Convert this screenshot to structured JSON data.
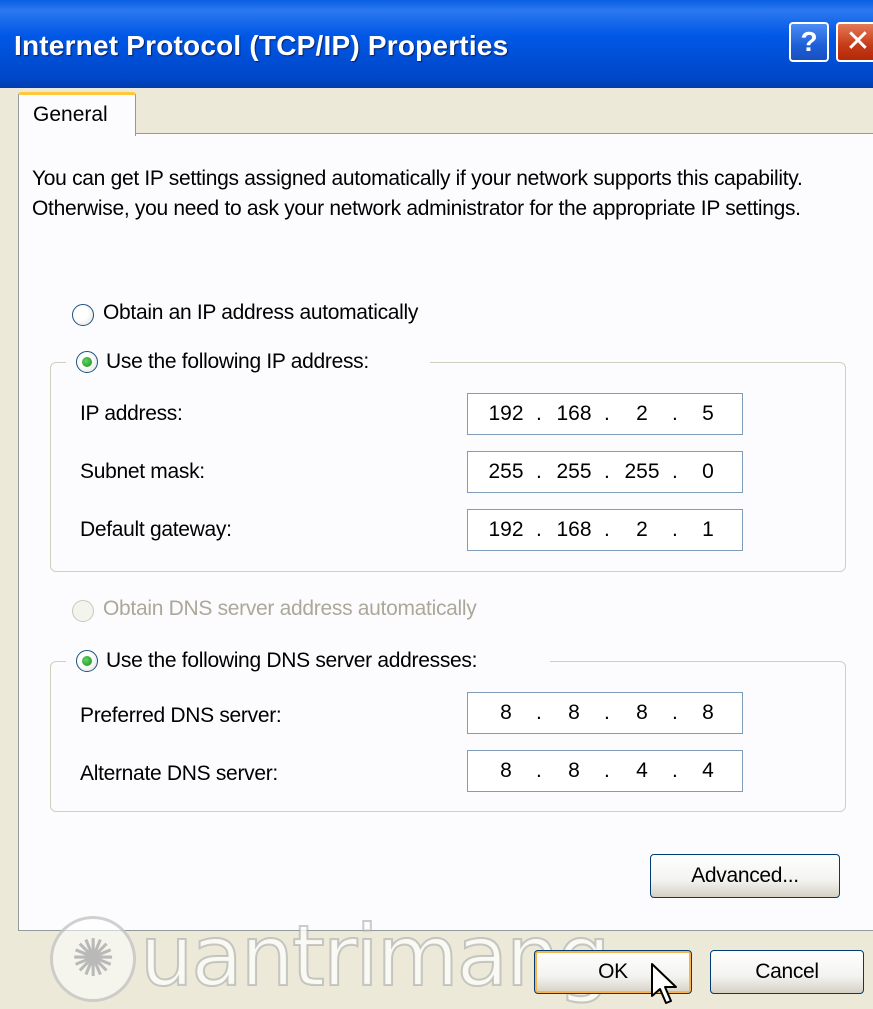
{
  "window": {
    "title": "Internet Protocol (TCP/IP) Properties",
    "help_label": "?",
    "close_label": "✕"
  },
  "tabs": [
    {
      "label": "General",
      "selected": true
    }
  ],
  "intro_text": "You can get IP settings assigned automatically if your network supports this capability. Otherwise, you need to ask your network administrator for the appropriate IP settings.",
  "ip_section": {
    "auto_option": {
      "label": "Obtain an IP address automatically",
      "checked": false
    },
    "manual_option": {
      "label": "Use the following IP address:",
      "checked": true
    },
    "fields": [
      {
        "label": "IP address:",
        "octets": [
          "192",
          "168",
          "2",
          "5"
        ]
      },
      {
        "label": "Subnet mask:",
        "octets": [
          "255",
          "255",
          "255",
          "0"
        ]
      },
      {
        "label": "Default gateway:",
        "octets": [
          "192",
          "168",
          "2",
          "1"
        ]
      }
    ]
  },
  "dns_section": {
    "auto_option": {
      "label": "Obtain DNS server address automatically",
      "checked": false,
      "disabled": true
    },
    "manual_option": {
      "label": "Use the following DNS server addresses:",
      "checked": true
    },
    "fields": [
      {
        "label": "Preferred DNS server:",
        "octets": [
          "8",
          "8",
          "8",
          "8"
        ]
      },
      {
        "label": "Alternate DNS server:",
        "octets": [
          "8",
          "8",
          "4",
          "4"
        ]
      }
    ]
  },
  "buttons": {
    "advanced": "Advanced...",
    "ok": "OK",
    "cancel": "Cancel"
  },
  "watermark": {
    "text": "uantrimang",
    "icon": "lightbulb-icon"
  },
  "colors": {
    "title_bar": "#0054E3",
    "close_button": "#C63A16",
    "dialog_bg": "#ECE9D8",
    "panel_bg": "#FCFCFE",
    "tab_accent": "#FFC83C"
  }
}
